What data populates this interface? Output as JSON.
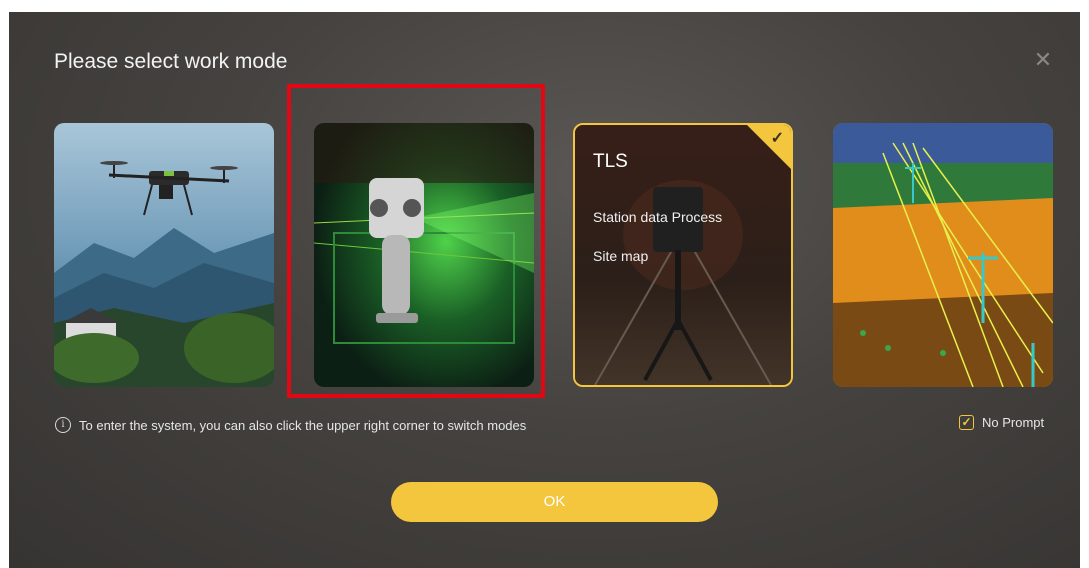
{
  "dialog": {
    "title": "Please select work mode",
    "close_glyph": "✕"
  },
  "cards": [
    {
      "name": "drone-mode",
      "image": "drone over mountains"
    },
    {
      "name": "handheld-mode",
      "image": "handheld scanner with green laser"
    },
    {
      "name": "tls-mode",
      "image": "tripod terrestrial laser scanner in tunnel",
      "selected": true,
      "title": "TLS",
      "items": [
        "Station data Process",
        "Site map"
      ]
    },
    {
      "name": "powerline-mode",
      "image": "colored point cloud of power lines"
    }
  ],
  "hint": {
    "icon": "i",
    "text": "To enter the system, you can also click the upper right corner to switch modes"
  },
  "no_prompt": {
    "checked": true,
    "label": "No Prompt",
    "check_glyph": "✓"
  },
  "ok_button": {
    "label": "OK"
  },
  "colors": {
    "accent": "#f3c63d",
    "highlight": "#e30613"
  }
}
